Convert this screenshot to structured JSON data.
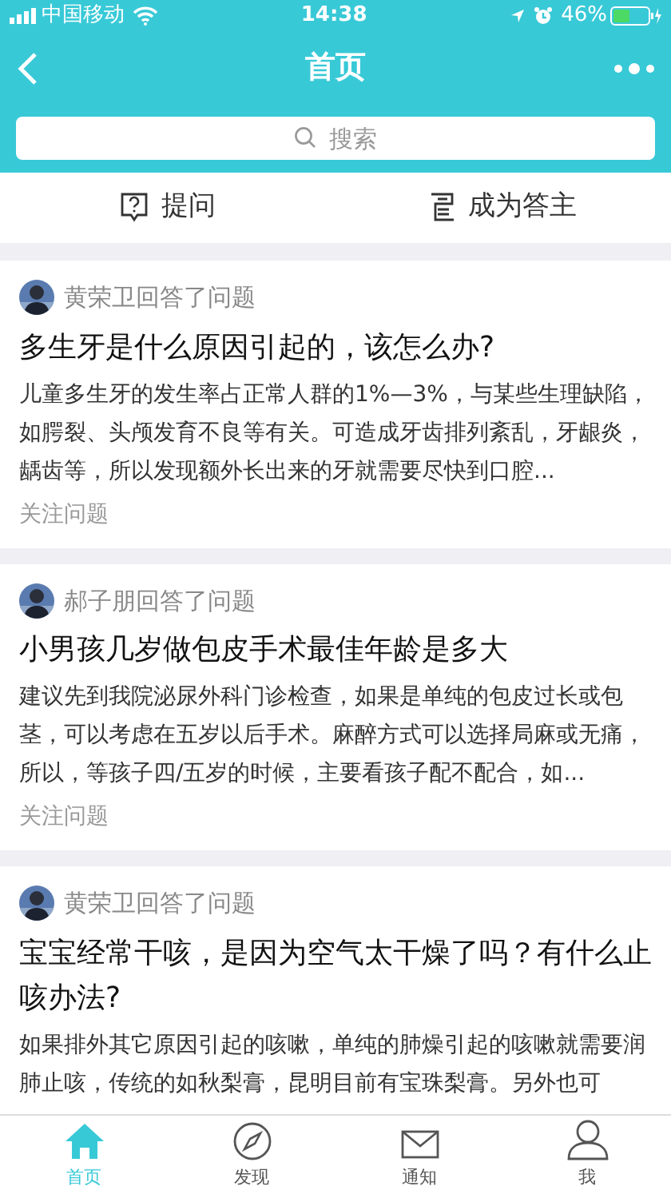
{
  "status_bar": {
    "carrier": "中国移动",
    "time": "14:38",
    "battery": "46%"
  },
  "nav": {
    "title": "首页"
  },
  "search": {
    "placeholder": "搜索"
  },
  "actions": [
    {
      "kind": "ask",
      "label": "提问"
    },
    {
      "kind": "answer",
      "label": "成为答主"
    }
  ],
  "feed": [
    {
      "author": "黄荣卫回答了问题",
      "title": "多生牙是什么原因引起的，该怎么办?",
      "body": "儿童多生牙的发生率占正常人群的1%—3%，与某些生理缺陷，如腭裂、头颅发育不良等有关。可造成牙齿排列紊乱，牙龈炎，龋齿等，所以发现额外长出来的牙就需要尽快到口腔...",
      "follow": "关注问题"
    },
    {
      "author": "郝子朋回答了问题",
      "title": "小男孩几岁做包皮手术最佳年龄是多大",
      "body": "建议先到我院泌尿外科门诊检查，如果是单纯的包皮过长或包茎，可以考虑在五岁以后手术。麻醉方式可以选择局麻或无痛，所以，等孩子四/五岁的时候，主要看孩子配不配合，如...",
      "follow": "关注问题"
    },
    {
      "author": "黄荣卫回答了问题",
      "title": "宝宝经常干咳，是因为空气太干燥了吗？有什么止咳办法?",
      "body": "如果排外其它原因引起的咳嗽，单纯的肺燥引起的咳嗽就需要润肺止咳，传统的如秋梨膏，昆明目前有宝珠梨膏。另外也可"
    }
  ],
  "tabbar": [
    {
      "kind": "home",
      "label": "首页",
      "selected": true
    },
    {
      "kind": "compass",
      "label": "发现",
      "selected": false
    },
    {
      "kind": "mail",
      "label": "通知",
      "selected": false
    },
    {
      "kind": "person",
      "label": "我",
      "selected": false
    }
  ]
}
